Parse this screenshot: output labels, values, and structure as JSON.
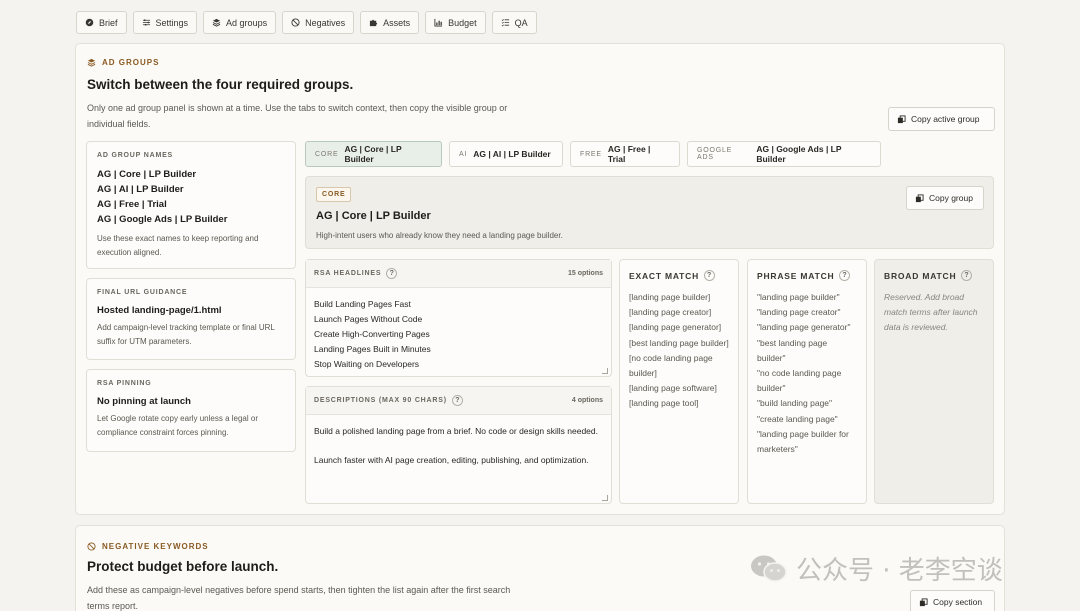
{
  "nav_tabs": [
    {
      "label": "Brief",
      "icon": "compass-icon"
    },
    {
      "label": "Settings",
      "icon": "sliders-icon"
    },
    {
      "label": "Ad groups",
      "icon": "layers-icon"
    },
    {
      "label": "Negatives",
      "icon": "ban-icon"
    },
    {
      "label": "Assets",
      "icon": "puzzle-icon"
    },
    {
      "label": "Budget",
      "icon": "chart-icon"
    },
    {
      "label": "QA",
      "icon": "checklist-icon"
    }
  ],
  "ad_groups": {
    "tag": "AD GROUPS",
    "title": "Switch between the four required groups.",
    "description": "Only one ad group panel is shown at a time. Use the tabs to switch context, then copy the visible group or individual fields.",
    "copy_active_label": "Copy active group",
    "names_box": {
      "label": "AD GROUP NAMES",
      "names": [
        "AG | Core | LP Builder",
        "AG | AI | LP Builder",
        "AG | Free | Trial",
        "AG | Google Ads | LP Builder"
      ],
      "note": "Use these exact names to keep reporting and execution aligned."
    },
    "final_url_box": {
      "label": "FINAL URL GUIDANCE",
      "value": "Hosted landing-page/1.html",
      "note": "Add campaign-level tracking template or final URL suffix for UTM parameters."
    },
    "pinning_box": {
      "label": "RSA PINNING",
      "value": "No pinning at launch",
      "note": "Let Google rotate copy early unless a legal or compliance constraint forces pinning."
    },
    "group_tabs": [
      {
        "code": "CORE",
        "name": "AG | Core | LP Builder"
      },
      {
        "code": "AI",
        "name": "AG | AI | LP Builder"
      },
      {
        "code": "FREE",
        "name": "AG | Free | Trial"
      },
      {
        "code": "GOOGLE ADS",
        "name": "AG | Google Ads | LP Builder"
      }
    ],
    "active_group": {
      "badge": "CORE",
      "title": "AG | Core | LP Builder",
      "subtitle": "High-intent users who already know they need a landing page builder.",
      "copy_label": "Copy group"
    },
    "headlines": {
      "label": "RSA HEADLINES",
      "count": "15 options",
      "items": [
        "Build Landing Pages Fast",
        "Launch Pages Without Code",
        "Create High-Converting Pages",
        "Landing Pages Built in Minutes",
        "Stop Waiting on Developers"
      ]
    },
    "descriptions": {
      "label": "DESCRIPTIONS (MAX 90 CHARS)",
      "count": "4 options",
      "items": [
        "Build a polished landing page from a brief. No code or design skills needed.",
        "Launch faster with AI page creation, editing, publishing, and optimization."
      ]
    },
    "exact_match": {
      "label": "EXACT MATCH",
      "items": [
        "[landing page builder]",
        "[landing page creator]",
        "[landing page generator]",
        "[best landing page builder]",
        "[no code landing page builder]",
        "[landing page software]",
        "[landing page tool]"
      ]
    },
    "phrase_match": {
      "label": "PHRASE MATCH",
      "items": [
        "\"landing page builder\"",
        "\"landing page creator\"",
        "\"landing page generator\"",
        "\"best landing page builder\"",
        "\"no code landing page builder\"",
        "\"build landing page\"",
        "\"create landing page\"",
        "\"landing page builder for marketers\""
      ]
    },
    "broad_match": {
      "label": "BROAD MATCH",
      "note": "Reserved. Add broad match terms after launch data is reviewed."
    }
  },
  "negatives": {
    "tag": "NEGATIVE KEYWORDS",
    "title": "Protect budget before launch.",
    "description": "Add these as campaign-level negatives before spend starts, then tighten the list again after the first search terms report.",
    "copy_label": "Copy section"
  },
  "watermark": "公众号 · 老李空谈"
}
